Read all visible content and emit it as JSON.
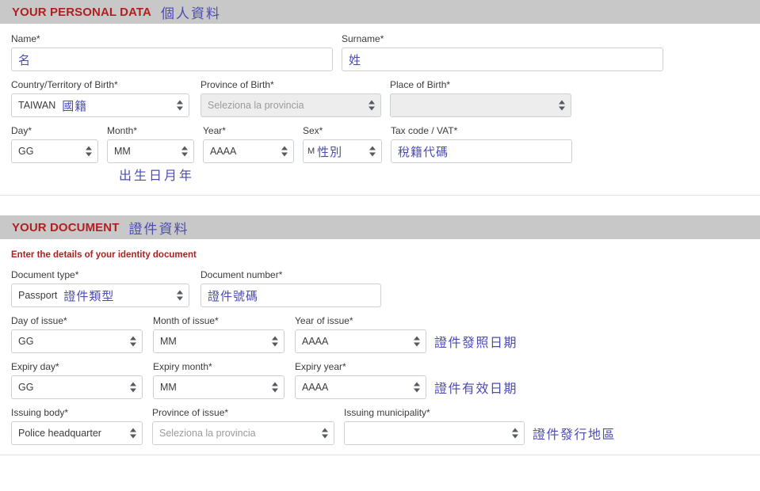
{
  "personal_section": {
    "title_en": "YOUR PERSONAL DATA",
    "title_zh": "個人資料",
    "name": {
      "label": "Name*",
      "value": "名"
    },
    "surname": {
      "label": "Surname*",
      "value": "姓"
    },
    "country_of_birth": {
      "label": "Country/Territory of Birth*",
      "value": "TAIWAN",
      "annotation": "國籍"
    },
    "province_of_birth": {
      "label": "Province of Birth*",
      "placeholder": "Seleziona la provincia"
    },
    "place_of_birth": {
      "label": "Place of Birth*",
      "value": ""
    },
    "day": {
      "label": "Day*",
      "value": "GG"
    },
    "month": {
      "label": "Month*",
      "value": "MM"
    },
    "year": {
      "label": "Year*",
      "value": "AAAA"
    },
    "sex": {
      "label": "Sex*",
      "value": "M",
      "annotation": "性別"
    },
    "tax_code": {
      "label": "Tax code / VAT*",
      "value": "稅籍代碼"
    },
    "birthdate_annotation": "出生日月年"
  },
  "document_section": {
    "title_en": "YOUR DOCUMENT",
    "title_zh": "證件資料",
    "sub_note": "Enter the details of your identity document",
    "document_type": {
      "label": "Document type*",
      "value": "Passport",
      "annotation": "證件類型"
    },
    "document_number": {
      "label": "Document number*",
      "value": "證件號碼"
    },
    "day_of_issue": {
      "label": "Day of issue*",
      "value": "GG"
    },
    "month_of_issue": {
      "label": "Month of issue*",
      "value": "MM"
    },
    "year_of_issue": {
      "label": "Year of issue*",
      "value": "AAAA"
    },
    "issue_date_annotation": "證件發照日期",
    "expiry_day": {
      "label": "Expiry day*",
      "value": "GG"
    },
    "expiry_month": {
      "label": "Expiry month*",
      "value": "MM"
    },
    "expiry_year": {
      "label": "Expiry year*",
      "value": "AAAA"
    },
    "expiry_date_annotation": "證件有效日期",
    "issuing_body": {
      "label": "Issuing body*",
      "value": "Police headquarter"
    },
    "province_of_issue": {
      "label": "Province of issue*",
      "placeholder": "Seleziona la provincia"
    },
    "issuing_municipality": {
      "label": "Issuing municipality*",
      "value": ""
    },
    "issuing_area_annotation": "證件發行地區"
  },
  "colors": {
    "header_red": "#b02020",
    "annotation_blue": "#4b4bb4",
    "bar_grey": "#c8c8c8"
  }
}
